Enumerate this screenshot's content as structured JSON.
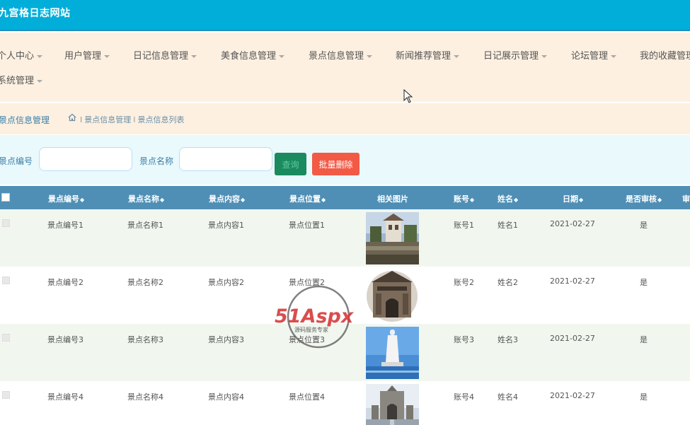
{
  "header": {
    "title": "九宫格日志网站"
  },
  "menu": {
    "items": [
      {
        "label": "个人中心"
      },
      {
        "label": "用户管理"
      },
      {
        "label": "日记信息管理"
      },
      {
        "label": "美食信息管理"
      },
      {
        "label": "景点信息管理"
      },
      {
        "label": "新闻推荐管理"
      },
      {
        "label": "日记展示管理"
      },
      {
        "label": "论坛管理"
      },
      {
        "label": "我的收藏管理"
      },
      {
        "label": "系统管理"
      }
    ]
  },
  "breadcrumb": {
    "current_section": "景点信息管理",
    "path": [
      "景点信息管理",
      "景点信息列表"
    ]
  },
  "search": {
    "field1_label": "景点编号",
    "field1_value": "",
    "field2_label": "景点名称",
    "field2_value": "",
    "query_button": "查询",
    "batch_delete_button": "批量删除"
  },
  "table": {
    "columns": [
      "景点编号",
      "景点名称",
      "景点内容",
      "景点位置",
      "相关图片",
      "账号",
      "姓名",
      "日期",
      "是否审核",
      "审"
    ],
    "rows": [
      {
        "code": "景点编号1",
        "name": "景点名称1",
        "content": "景点内容1",
        "location": "景点位置1",
        "image": "landmark-photo-tower",
        "account": "账号1",
        "person": "姓名1",
        "date": "2021-02-27",
        "reviewed": "是"
      },
      {
        "code": "景点编号2",
        "name": "景点名称2",
        "content": "景点内容2",
        "location": "景点位置2",
        "image": "landmark-photo-gate",
        "account": "账号2",
        "person": "姓名2",
        "date": "2021-02-27",
        "reviewed": "是"
      },
      {
        "code": "景点编号3",
        "name": "景点名称3",
        "content": "景点内容3",
        "location": "景点位置3",
        "image": "landmark-photo-statue",
        "account": "账号3",
        "person": "姓名3",
        "date": "2021-02-27",
        "reviewed": "是"
      },
      {
        "code": "景点编号4",
        "name": "景点名称4",
        "content": "景点内容4",
        "location": "景点位置4",
        "image": "landmark-photo-arch",
        "account": "账号4",
        "person": "姓名4",
        "date": "2021-02-27",
        "reviewed": "是"
      }
    ]
  },
  "watermark": {
    "brand": "51Aspx",
    "tagline": "源码服务专家"
  },
  "colors": {
    "topbar": "#00aed9",
    "menubar": "#fdf0e1",
    "table_header": "#4f8fb6",
    "query_button": "#1c8a5f",
    "delete_button": "#f25a46"
  }
}
